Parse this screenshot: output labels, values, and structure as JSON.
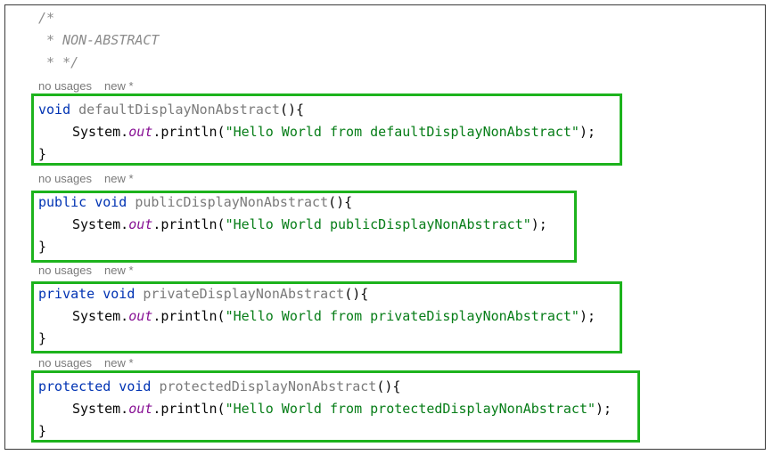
{
  "comment": {
    "lines": [
      "/*",
      " * NON-ABSTRACT",
      " * */"
    ]
  },
  "hints": {
    "usages": "no usages",
    "new": "new *"
  },
  "methods": [
    {
      "modifiers": "void",
      "name": "defaultDisplayNonAbstract",
      "signature_tail": "(){",
      "body_receiver": "System.",
      "body_field": "out",
      "body_call": ".println(",
      "body_string": "\"Hello World from defaultDisplayNonAbstract\"",
      "body_end": ");",
      "close": "}"
    },
    {
      "modifiers": "public void",
      "name": "publicDisplayNonAbstract",
      "signature_tail": "(){",
      "body_receiver": "System.",
      "body_field": "out",
      "body_call": ".println(",
      "body_string": "\"Hello World publicDisplayNonAbstract\"",
      "body_end": ");",
      "close": "}"
    },
    {
      "modifiers": "private void",
      "name": "privateDisplayNonAbstract",
      "signature_tail": "(){",
      "body_receiver": "System.",
      "body_field": "out",
      "body_call": ".println(",
      "body_string": "\"Hello World from privateDisplayNonAbstract\"",
      "body_end": ");",
      "close": "}"
    },
    {
      "modifiers": "protected void",
      "name": "protectedDisplayNonAbstract",
      "signature_tail": "(){",
      "body_receiver": "System.",
      "body_field": "out",
      "body_call": ".println(",
      "body_string": "\"Hello World from protectedDisplayNonAbstract\"",
      "body_end": ");",
      "close": "}"
    }
  ],
  "colors": {
    "highlight_box": "#1db31d",
    "keyword": "#0033b3",
    "string": "#067d17",
    "field": "#871094",
    "comment": "#8c8c8c"
  }
}
